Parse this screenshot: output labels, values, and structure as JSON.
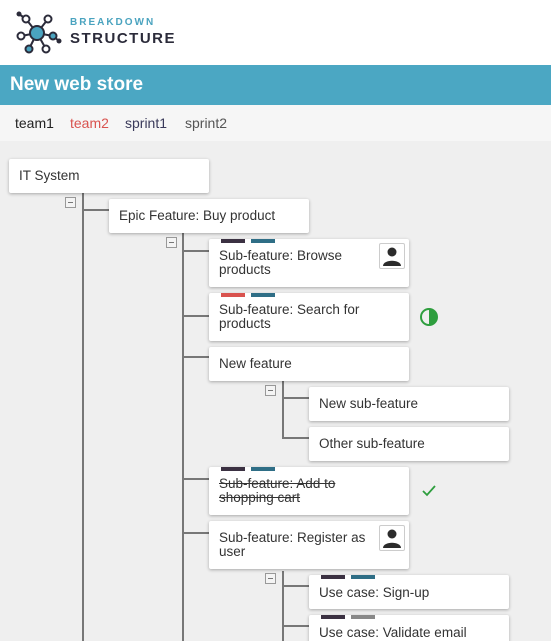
{
  "brand": {
    "line1": "BREAKDOWN",
    "line2": "STRUCTURE"
  },
  "project": {
    "title": "New web store"
  },
  "tags": [
    {
      "label": "team1",
      "color": "#222222"
    },
    {
      "label": "team2",
      "color": "#d9534f"
    },
    {
      "label": "sprint1",
      "color": "#3a3a5a"
    },
    {
      "label": "sprint2",
      "color": "#555555"
    }
  ],
  "colors": {
    "accent": "#4ba7c3",
    "bar_dark": "#3b3142",
    "bar_teal": "#2f6e86",
    "bar_red": "#d9534f",
    "bar_gray": "#888888",
    "status_green": "#2e9e3e"
  },
  "tree": {
    "root": {
      "label": "IT System"
    },
    "epic": {
      "label": "Epic Feature: Buy product"
    },
    "browse": {
      "label": "Sub-feature: Browse products",
      "icon": "person-icon"
    },
    "search": {
      "label": "Sub-feature: Search for products",
      "status": "half-circle-icon"
    },
    "newfeature": {
      "label": "New feature"
    },
    "newsub": {
      "label": "New sub-feature"
    },
    "othersub": {
      "label": "Other sub-feature"
    },
    "cart": {
      "label": "Sub-feature: Add to shopping cart",
      "status": "checkmark-icon",
      "done": true
    },
    "register": {
      "label": "Sub-feature: Register as user",
      "icon": "person-icon"
    },
    "signup": {
      "label": "Use case: Sign-up"
    },
    "validate": {
      "label": "Use case: Validate email"
    }
  }
}
